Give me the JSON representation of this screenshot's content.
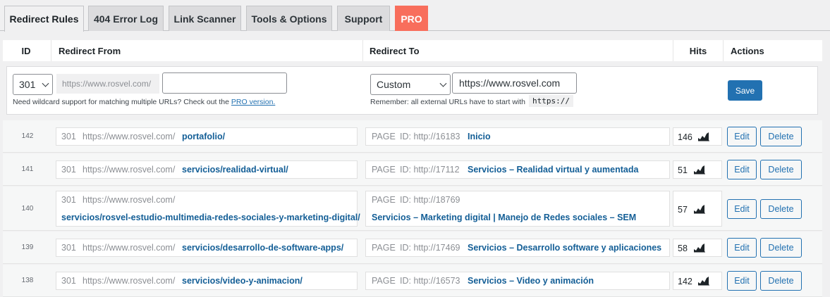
{
  "tabs": [
    {
      "label": "Redirect Rules"
    },
    {
      "label": "404 Error Log"
    },
    {
      "label": "Link Scanner"
    },
    {
      "label": "Tools & Options"
    },
    {
      "label": "Support"
    },
    {
      "label": "PRO"
    }
  ],
  "headers": {
    "id": "ID",
    "from": "Redirect From",
    "to": "Redirect To",
    "hits": "Hits",
    "actions": "Actions"
  },
  "new_rule": {
    "status_code": "301",
    "prefix": "https://www.rosvel.com/",
    "from_value": "",
    "hint_from": "Need wildcard support for matching multiple URLs? Check out the ",
    "hint_link": "PRO version.",
    "to_type": "Custom",
    "to_value": "https://www.rosvel.com",
    "hint_to": "Remember: all external URLs have to start with",
    "hint_code": "https://",
    "save_label": "Save"
  },
  "rows": [
    {
      "id": "142",
      "code": "301",
      "prefix": "https://www.rosvel.com/",
      "from": "portafolio/",
      "type": "PAGE",
      "target_id": "ID: http://16183",
      "target": "Inicio",
      "hits": "146",
      "edit": "Edit",
      "delete": "Delete"
    },
    {
      "id": "141",
      "code": "301",
      "prefix": "https://www.rosvel.com/",
      "from": "servicios/realidad-virtual/",
      "type": "PAGE",
      "target_id": "ID: http://17112",
      "target": "Servicios – Realidad virtual y aumentada",
      "hits": "51",
      "edit": "Edit",
      "delete": "Delete"
    },
    {
      "id": "140",
      "code": "301",
      "prefix": "https://www.rosvel.com/",
      "from": "servicios/rosvel-estudio-multimedia-redes-sociales-y-marketing-digital/",
      "type": "PAGE",
      "target_id": "ID: http://18769",
      "target": "Servicios – Marketing digital | Manejo de Redes sociales – SEM",
      "hits": "57",
      "edit": "Edit",
      "delete": "Delete"
    },
    {
      "id": "139",
      "code": "301",
      "prefix": "https://www.rosvel.com/",
      "from": "servicios/desarrollo-de-software-apps/",
      "type": "PAGE",
      "target_id": "ID: http://17469",
      "target": "Servicios – Desarrollo software y aplicaciones",
      "hits": "58",
      "edit": "Edit",
      "delete": "Delete"
    },
    {
      "id": "138",
      "code": "301",
      "prefix": "https://www.rosvel.com/",
      "from": "servicios/video-y-animacion/",
      "type": "PAGE",
      "target_id": "ID: http://16573",
      "target": "Servicios – Video y animación",
      "hits": "142",
      "edit": "Edit",
      "delete": "Delete"
    }
  ],
  "colors": {
    "accent": "#2271b1",
    "pro": "#f86e5c"
  },
  "icons": {
    "hits": "chart-icon",
    "dropdown": "chevron-down-icon"
  }
}
